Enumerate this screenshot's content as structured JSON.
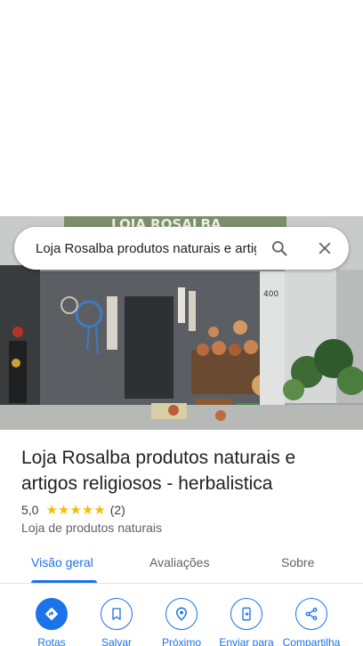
{
  "search": {
    "query": "Loja Rosalba produtos naturais e artigos religiosos - herbalistica",
    "search_icon": "search-icon",
    "close_icon": "close-icon"
  },
  "photo": {
    "sign_text": "LOJA ROSALBA",
    "door_number": "400"
  },
  "place": {
    "title": "Loja Rosalba produtos naturais e artigos religiosos - herbalistica",
    "rating": "5,0",
    "stars": 5,
    "review_count": "(2)",
    "category": "Loja de produtos naturais"
  },
  "tabs": [
    {
      "label": "Visão geral",
      "active": true
    },
    {
      "label": "Avaliações",
      "active": false
    },
    {
      "label": "Sobre",
      "active": false
    }
  ],
  "actions": [
    {
      "label": "Rotas",
      "icon": "directions-icon"
    },
    {
      "label": "Salvar",
      "icon": "bookmark-icon"
    },
    {
      "label": "Próximo",
      "icon": "nearby-icon"
    },
    {
      "label": "Enviar para",
      "icon": "send-to-phone-icon"
    },
    {
      "label": "Compartilha",
      "icon": "share-icon"
    }
  ],
  "colors": {
    "accent": "#1a73e8",
    "star": "#fbbc04",
    "text": "#202124",
    "secondary_text": "#5f6368"
  }
}
